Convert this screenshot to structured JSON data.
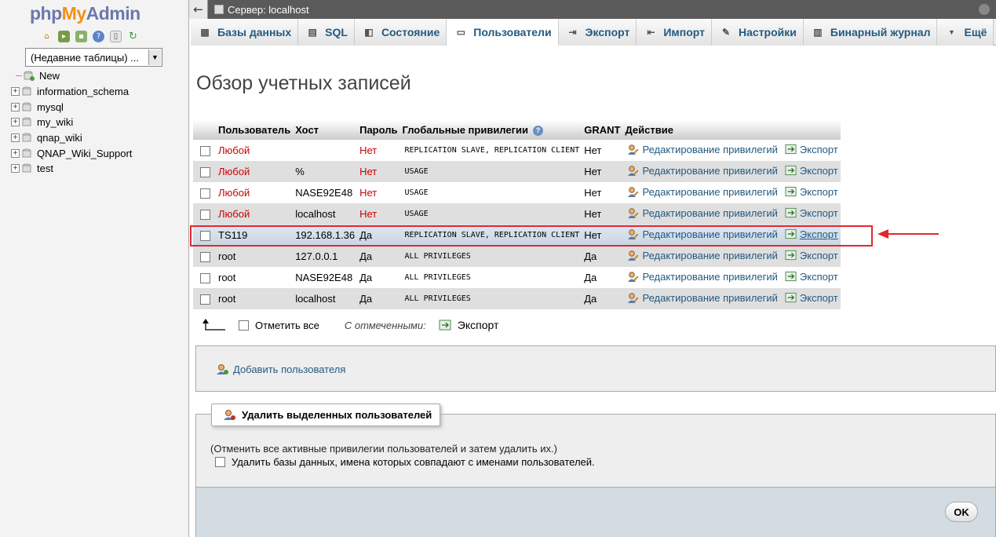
{
  "nav": {
    "logo_php": "php",
    "logo_my": "My",
    "logo_admin": "Admin",
    "icons": [
      "home-icon",
      "logout-icon",
      "query-window-icon",
      "help-icon",
      "docs-icon",
      "reload-icon"
    ],
    "recent_tables": "(Недавние таблицы) ...",
    "tree": [
      {
        "label": "New",
        "type": "new"
      },
      {
        "label": "information_schema",
        "type": "db"
      },
      {
        "label": "mysql",
        "type": "db"
      },
      {
        "label": "my_wiki",
        "type": "db"
      },
      {
        "label": "qnap_wiki",
        "type": "db"
      },
      {
        "label": "QNAP_Wiki_Support",
        "type": "db"
      },
      {
        "label": "test",
        "type": "db"
      }
    ]
  },
  "topbar": {
    "back": "←",
    "server": "Сервер: localhost"
  },
  "tabs": [
    {
      "label": "Базы данных",
      "icon": "databases-icon",
      "glyph": "▦"
    },
    {
      "label": "SQL",
      "icon": "sql-icon",
      "glyph": "▤"
    },
    {
      "label": "Состояние",
      "icon": "status-icon",
      "glyph": "◧"
    },
    {
      "label": "Пользователи",
      "icon": "users-icon",
      "glyph": "▭",
      "active": true
    },
    {
      "label": "Экспорт",
      "icon": "export-icon",
      "glyph": "⇥"
    },
    {
      "label": "Импорт",
      "icon": "import-icon",
      "glyph": "⇤"
    },
    {
      "label": "Настройки",
      "icon": "settings-icon",
      "glyph": "✎"
    },
    {
      "label": "Бинарный журнал",
      "icon": "binlog-icon",
      "glyph": "▥"
    },
    {
      "label": "Ещё",
      "icon": "more-icon",
      "glyph": "▼"
    }
  ],
  "page_title": "Обзор учетных записей",
  "table": {
    "headers": {
      "user": "Пользователь",
      "host": "Хост",
      "password": "Пароль",
      "privileges": "Глобальные привилегии",
      "grant": "GRANT",
      "action": "Действие"
    },
    "edit_label": "Редактирование привилегий",
    "export_label": "Экспорт",
    "rows": [
      {
        "user": "Любой",
        "host": "",
        "password": "Нет",
        "privileges": "REPLICATION SLAVE, REPLICATION CLIENT",
        "grant": "Нет",
        "any": true
      },
      {
        "user": "Любой",
        "host": "%",
        "password": "Нет",
        "privileges": "USAGE",
        "grant": "Нет",
        "any": true
      },
      {
        "user": "Любой",
        "host": "NASE92E48",
        "password": "Нет",
        "privileges": "USAGE",
        "grant": "Нет",
        "any": true
      },
      {
        "user": "Любой",
        "host": "localhost",
        "password": "Нет",
        "privileges": "USAGE",
        "grant": "Нет",
        "any": true
      },
      {
        "user": "TS119",
        "host": "192.168.1.36",
        "password": "Да",
        "privileges": "REPLICATION SLAVE, REPLICATION CLIENT",
        "grant": "Нет",
        "any": false,
        "selected": true
      },
      {
        "user": "root",
        "host": "127.0.0.1",
        "password": "Да",
        "privileges": "ALL PRIVILEGES",
        "grant": "Да",
        "any": false
      },
      {
        "user": "root",
        "host": "NASE92E48",
        "password": "Да",
        "privileges": "ALL PRIVILEGES",
        "grant": "Да",
        "any": false
      },
      {
        "user": "root",
        "host": "localhost",
        "password": "Да",
        "privileges": "ALL PRIVILEGES",
        "grant": "Да",
        "any": false
      }
    ]
  },
  "bulk": {
    "check_all": "Отметить все",
    "with_selected": "С отмеченными:",
    "export": "Экспорт"
  },
  "add_user": "Добавить пользователя",
  "delete_section": {
    "legend": "Удалить выделенных пользователей",
    "note": "(Отменить все активные привилегии пользователей и затем удалить их.)",
    "drop_db": "Удалить базы данных, имена которых совпадают с именами пользователей.",
    "ok": "OK"
  },
  "colors": {
    "link": "#235a81",
    "any_user": "#cc0000",
    "highlight": "#e2282e"
  }
}
